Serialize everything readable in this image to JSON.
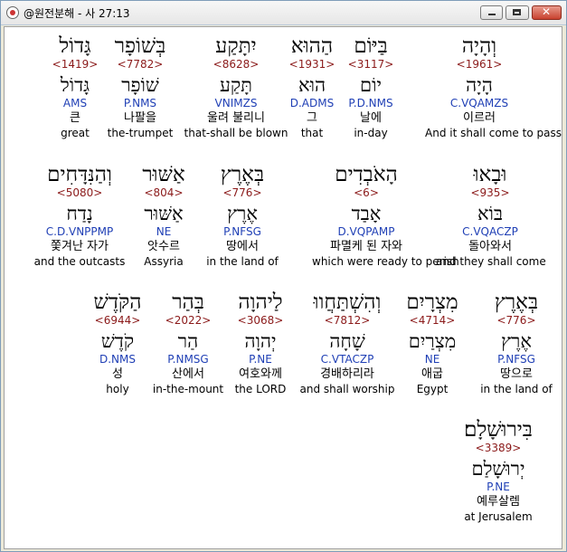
{
  "window": {
    "title": "@원전분해 - 사 27:13"
  },
  "words": [
    {
      "heb": "וְהָיָה",
      "num": "<1961>",
      "lemma": "הָיָה",
      "morph": "C.VQAMZS",
      "kor": "이르러",
      "eng": "And it shall come to pass"
    },
    {
      "heb": "בַּיּוֹם",
      "num": "<3117>",
      "lemma": "יוֹם",
      "morph": "P.D.NMS",
      "kor": "날에",
      "eng": "in-day"
    },
    {
      "heb": "הַהוּא",
      "num": "<1931>",
      "lemma": "הוּא",
      "morph": "D.ADMS",
      "kor": "그",
      "eng": "that"
    },
    {
      "heb": "יִתָּקַע",
      "num": "<8628>",
      "lemma": "תָּקַע",
      "morph": "VNIMZS",
      "kor": "울려 불리니",
      "eng": "that-shall be blown"
    },
    {
      "heb": "בְּשׁוֹפָר",
      "num": "<7782>",
      "lemma": "שׁוֹפָר",
      "morph": "P.NMS",
      "kor": "나팔을",
      "eng": "the-trumpet"
    },
    {
      "heb": "גָּדוֹל",
      "num": "<1419>",
      "lemma": "גָּדוֹל",
      "morph": "AMS",
      "kor": "큰",
      "eng": "great"
    },
    {
      "heb": "וּבָאוּ",
      "num": "<935>",
      "lemma": "בּוֹא",
      "morph": "C.VQACZP",
      "kor": "돌아와서",
      "eng": "and they shall come"
    },
    {
      "heb": "הָאֹבְדִים",
      "num": "<6>",
      "lemma": "אָבַד",
      "morph": "D.VQPAMP",
      "kor": "파멸케 된 자와",
      "eng": "which were ready to perish"
    },
    {
      "heb": "בְּאֶרֶץ",
      "num": "<776>",
      "lemma": "אֶרֶץ",
      "morph": "P.NFSG",
      "kor": "땅에서",
      "eng": "in the land of"
    },
    {
      "heb": "אַשּׁוּר",
      "num": "<804>",
      "lemma": "אַשּׁוּר",
      "morph": "NE",
      "kor": "앗수르",
      "eng": "Assyria"
    },
    {
      "heb": "וְהַנִּדָּחִים",
      "num": "<5080>",
      "lemma": "נָדַח",
      "morph": "C.D.VNPPMP",
      "kor": "쫓겨난 자가",
      "eng": "and the outcasts"
    },
    {
      "heb": "בְּאֶרֶץ",
      "num": "<776>",
      "lemma": "אֶרֶץ",
      "morph": "P.NFSG",
      "kor": "땅으로",
      "eng": "in the land of"
    },
    {
      "heb": "מִצְרָיִם",
      "num": "<4714>",
      "lemma": "מִצְרַיִם",
      "morph": "NE",
      "kor": "애굽",
      "eng": "Egypt"
    },
    {
      "heb": "וְהִשְׁתַּחֲווּ",
      "num": "<7812>",
      "lemma": "שָׁחָה",
      "morph": "C.VTACZP",
      "kor": "경배하리라",
      "eng": "and shall worship"
    },
    {
      "heb": "לַיהוָה",
      "num": "<3068>",
      "lemma": "יְהוָה",
      "morph": "P.NE",
      "kor": "여호와께",
      "eng": "the LORD"
    },
    {
      "heb": "בְּהַר",
      "num": "<2022>",
      "lemma": "הַר",
      "morph": "P.NMSG",
      "kor": "산에서",
      "eng": "in-the-mount"
    },
    {
      "heb": "הַקֹּדֶשׁ",
      "num": "<6944>",
      "lemma": "קֹדֶשׁ",
      "morph": "D.NMS",
      "kor": "성",
      "eng": "holy"
    },
    {
      "heb": "בִּירוּשָׁלָם׃",
      "num": "<3389>",
      "lemma": "יְרוּשָׁלַם",
      "morph": "P.NE",
      "kor": "예루살렘",
      "eng": "at Jerusalem"
    }
  ]
}
